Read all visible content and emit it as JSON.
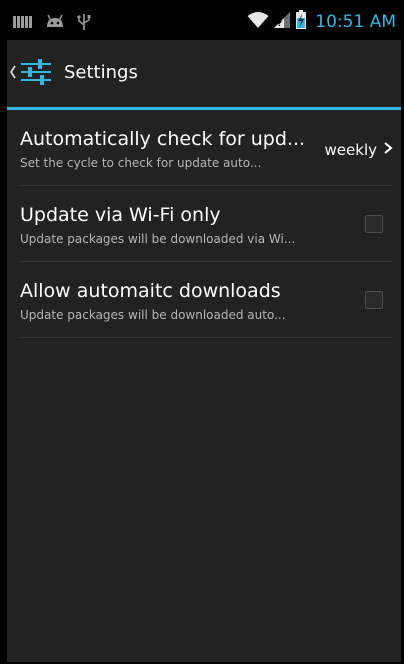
{
  "status_bar": {
    "left_icons": [
      "sim-icon",
      "android-icon",
      "usb-icon"
    ],
    "right_icons": [
      "wifi-icon",
      "signal-icon",
      "battery-icon"
    ],
    "time": "10:51 AM",
    "time_color": "#33b5e5"
  },
  "action_bar": {
    "title": "Settings",
    "icon": "sliders-icon"
  },
  "accent_color": "#33b5e5",
  "preferences": [
    {
      "title": "Automatically check for upd...",
      "summary": "Set the cycle to check for update auto...",
      "value": "weekly",
      "widget": "chevron"
    },
    {
      "title": "Update via Wi-Fi only",
      "summary": "Update packages will be downloaded via Wi...",
      "widget": "checkbox",
      "checked": false
    },
    {
      "title": "Allow automaitc downloads",
      "summary": "Update packages will be downloaded auto...",
      "widget": "checkbox",
      "checked": false
    }
  ]
}
